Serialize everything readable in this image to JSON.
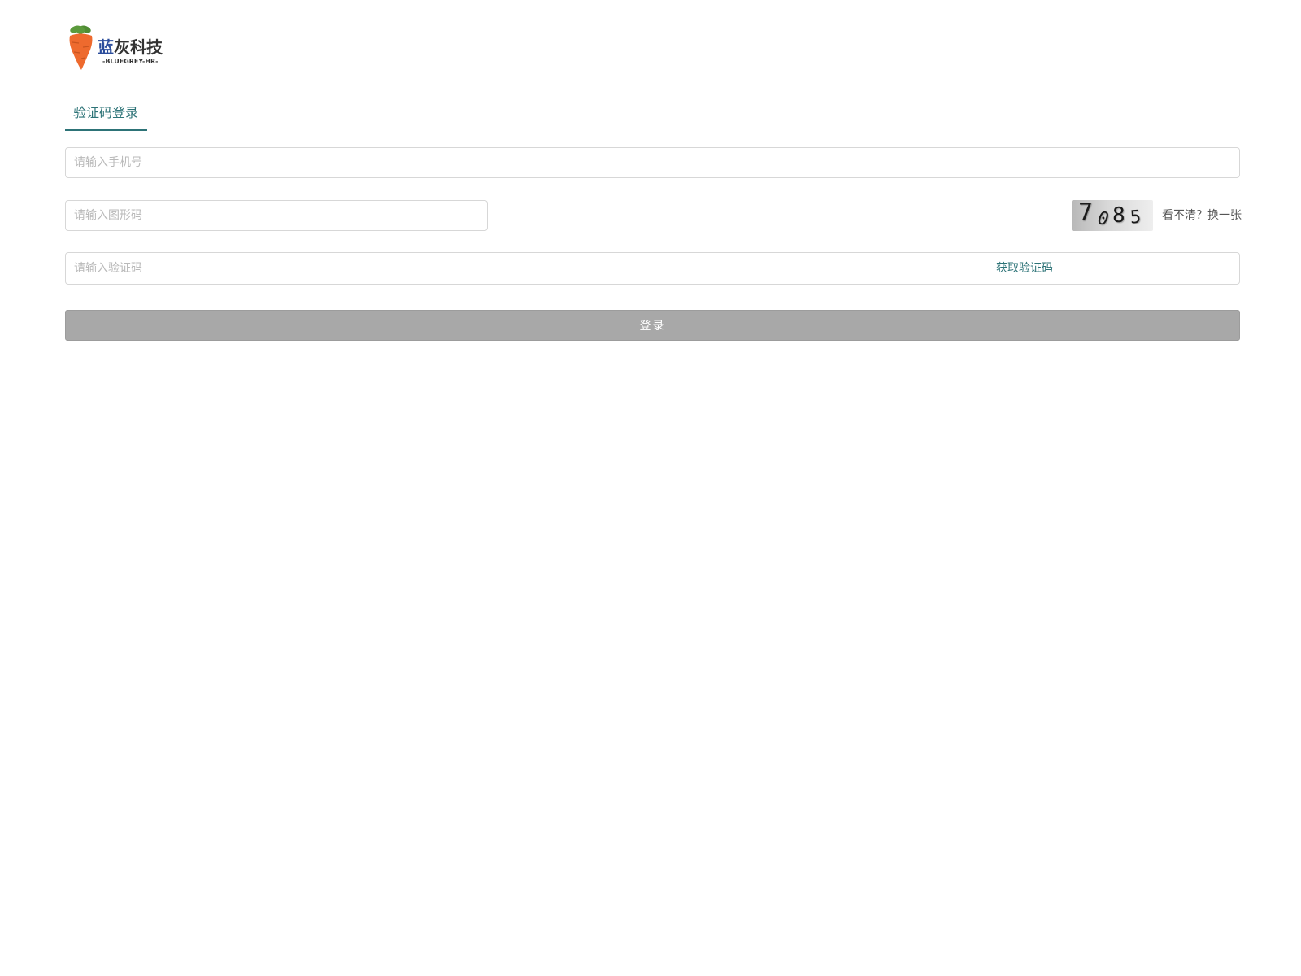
{
  "logo": {
    "name_first": "蓝",
    "name_rest": "灰科技",
    "subtitle": "-BLUEGREY-HR-",
    "icon": "carrot-icon",
    "carrot_color": "#ee6a2e",
    "leaf_color": "#5b9a3c"
  },
  "tabs": [
    {
      "label": "验证码登录",
      "active": true
    }
  ],
  "form": {
    "phone_placeholder": "请输入手机号",
    "captcha_placeholder": "请输入图形码",
    "code_placeholder": "请输入验证码",
    "get_code_label": "获取验证码",
    "captcha_image": {
      "digits": [
        "7",
        "0",
        "8",
        "5"
      ]
    },
    "refresh_label": "看不清？换一张",
    "login_label": "登录"
  },
  "colors": {
    "accent": "#2d7377",
    "button_disabled": "#a8a8a8",
    "placeholder": "#b9b9b9",
    "border": "#d7d7d7"
  }
}
